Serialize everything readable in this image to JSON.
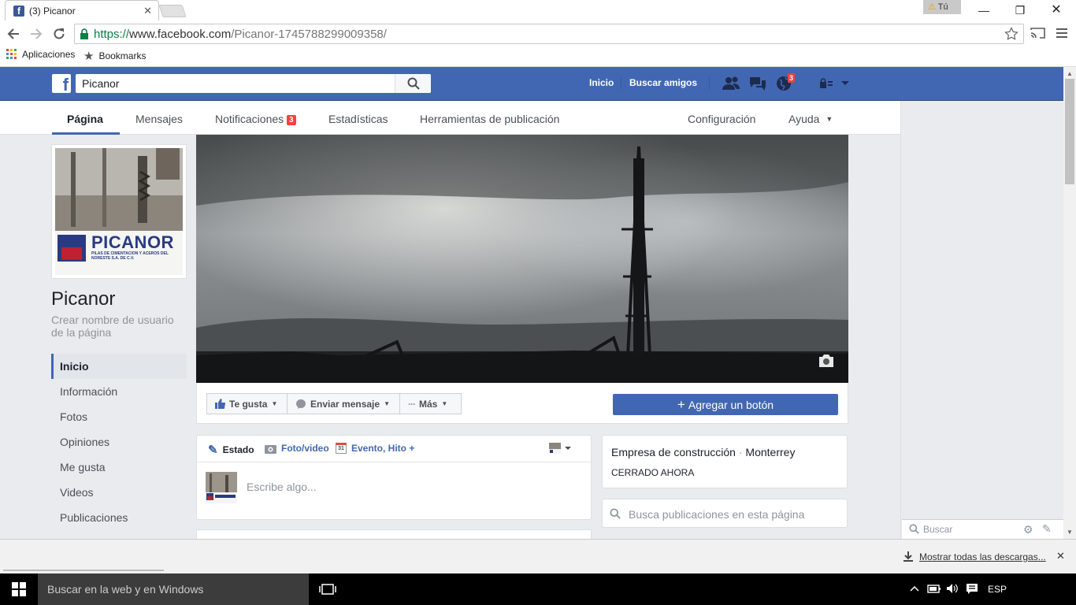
{
  "browser": {
    "tab_title": "(3) Picanor",
    "user_label": "Tú",
    "url_scheme": "https://",
    "url_host": "www.facebook.com",
    "url_path": "/Picanor-1745788299009358/",
    "bookmarks": [
      "Aplicaciones",
      "Bookmarks"
    ]
  },
  "fb_header": {
    "search_value": "Picanor",
    "links": [
      "Inicio",
      "Buscar amigos"
    ],
    "notifications_count": "3"
  },
  "page_tabs": {
    "items": [
      "Página",
      "Mensajes",
      "Notificaciones",
      "Estadísticas",
      "Herramientas de publicación"
    ],
    "notifications_badge": "3",
    "right_items": [
      "Configuración",
      "Ayuda"
    ]
  },
  "profile": {
    "logo_text": "PICANOR",
    "logo_subtitle": "PILAS DE CIMENTACION Y ACEROS DEL NORESTE S.A. DE C.V.",
    "page_name": "Picanor",
    "username_prompt": "Crear nombre de usuario de la página"
  },
  "left_nav": [
    "Inicio",
    "Información",
    "Fotos",
    "Opiniones",
    "Me gusta",
    "Videos",
    "Publicaciones"
  ],
  "actions": {
    "like": "Te gusta",
    "message": "Enviar mensaje",
    "more": "Más",
    "add_button": "Agregar un botón"
  },
  "composer": {
    "tabs": [
      "Estado",
      "Foto/video",
      "Evento, Hito +"
    ],
    "calendar_day": "31",
    "placeholder": "Escribe algo..."
  },
  "info": {
    "category": "Empresa de construcción",
    "city": "Monterrey",
    "status": "CERRADO AHORA",
    "search_placeholder": "Busca publicaciones en esta página"
  },
  "chat": {
    "search_placeholder": "Buscar"
  },
  "downloads": {
    "show_all": "Mostrar todas las descargas..."
  },
  "taskbar": {
    "search_placeholder": "Buscar en la web y en Windows",
    "language": "ESP"
  }
}
